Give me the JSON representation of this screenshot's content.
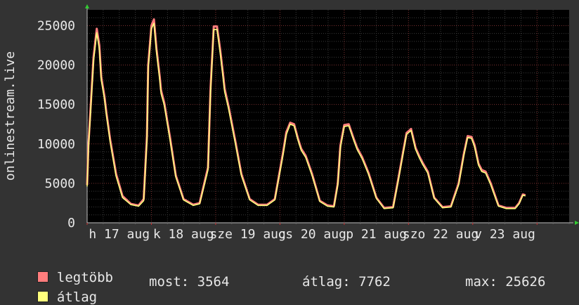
{
  "chart_data": {
    "type": "line",
    "ylabel": "onlinestream.live",
    "y_ticks": [
      "0",
      "5000",
      "10000",
      "15000",
      "20000",
      "25000"
    ],
    "ylim": [
      0,
      27000
    ],
    "x_tick_labels": [
      "h 17 aug",
      "k 18 aug",
      "sze 19 aug",
      "cs 20 aug",
      "p 21 aug",
      "szo 22 aug",
      "v 23 aug"
    ],
    "x_day_range": [
      0,
      7.5
    ],
    "grid": true,
    "series": [
      {
        "name": "legtöbb",
        "color": "#ff7d7d",
        "x": [
          0,
          0.02,
          0.1,
          0.15,
          0.19,
          0.22,
          0.27,
          0.3,
          0.36,
          0.45,
          0.55,
          0.68,
          0.8,
          0.88,
          0.93,
          0.95,
          1.0,
          1.04,
          1.08,
          1.13,
          1.15,
          1.2,
          1.29,
          1.38,
          1.5,
          1.65,
          1.75,
          1.88,
          1.92,
          1.97,
          2.02,
          2.07,
          2.12,
          2.14,
          2.2,
          2.3,
          2.4,
          2.53,
          2.66,
          2.8,
          2.92,
          3.05,
          3.1,
          3.16,
          3.22,
          3.28,
          3.33,
          3.4,
          3.5,
          3.62,
          3.74,
          3.84,
          3.9,
          3.94,
          4.0,
          4.07,
          4.15,
          4.2,
          4.28,
          4.38,
          4.5,
          4.62,
          4.76,
          4.84,
          4.91,
          4.97,
          5.04,
          5.11,
          5.17,
          5.22,
          5.3,
          5.4,
          5.53,
          5.66,
          5.78,
          5.86,
          5.92,
          5.98,
          6.03,
          6.09,
          6.14,
          6.2,
          6.28,
          6.4,
          6.52,
          6.66,
          6.72,
          6.78,
          6.82
        ],
        "y": [
          4800,
          9800,
          21000,
          24600,
          22500,
          18500,
          16000,
          14000,
          10500,
          6200,
          3400,
          2400,
          2200,
          3000,
          11000,
          20000,
          25000,
          25800,
          22000,
          18500,
          16800,
          15200,
          10800,
          6000,
          3000,
          2300,
          2500,
          7000,
          17000,
          24900,
          24900,
          22000,
          18500,
          17000,
          14800,
          10600,
          6200,
          3000,
          2300,
          2300,
          3000,
          9000,
          11500,
          12700,
          12500,
          10700,
          9400,
          8500,
          6200,
          2800,
          2200,
          2100,
          5000,
          9800,
          12400,
          12500,
          10600,
          9500,
          8300,
          6300,
          3200,
          1900,
          2000,
          5500,
          8700,
          11400,
          11900,
          9500,
          8400,
          7600,
          6500,
          3200,
          2000,
          2100,
          5000,
          8700,
          11000,
          10900,
          9800,
          7500,
          6700,
          6500,
          5000,
          2200,
          1900,
          1900,
          2500,
          3600,
          3500
        ]
      },
      {
        "name": "átlag",
        "color": "#ffff7d",
        "x": [
          0,
          0.02,
          0.1,
          0.15,
          0.19,
          0.22,
          0.27,
          0.3,
          0.36,
          0.45,
          0.55,
          0.68,
          0.8,
          0.88,
          0.93,
          0.95,
          1.0,
          1.04,
          1.08,
          1.13,
          1.15,
          1.2,
          1.29,
          1.38,
          1.5,
          1.65,
          1.75,
          1.88,
          1.92,
          1.97,
          2.02,
          2.07,
          2.12,
          2.14,
          2.2,
          2.3,
          2.4,
          2.53,
          2.66,
          2.8,
          2.92,
          3.05,
          3.1,
          3.16,
          3.22,
          3.28,
          3.33,
          3.4,
          3.5,
          3.62,
          3.74,
          3.84,
          3.9,
          3.94,
          4.0,
          4.07,
          4.15,
          4.2,
          4.28,
          4.38,
          4.5,
          4.62,
          4.76,
          4.84,
          4.91,
          4.97,
          5.04,
          5.11,
          5.17,
          5.22,
          5.3,
          5.4,
          5.53,
          5.66,
          5.78,
          5.86,
          5.92,
          5.98,
          6.03,
          6.09,
          6.14,
          6.2,
          6.28,
          6.4,
          6.52,
          6.66,
          6.72,
          6.78,
          6.82
        ],
        "y": [
          4600,
          9400,
          20500,
          24100,
          22000,
          18100,
          15700,
          13700,
          10200,
          5900,
          3200,
          2300,
          2100,
          2800,
          10500,
          19600,
          24600,
          25300,
          21600,
          18100,
          16400,
          14900,
          10500,
          5800,
          2900,
          2200,
          2400,
          6700,
          16600,
          24500,
          24500,
          21600,
          18100,
          16600,
          14500,
          10300,
          6000,
          2900,
          2200,
          2200,
          2900,
          8700,
          11200,
          12500,
          12300,
          10500,
          9200,
          8300,
          6000,
          2700,
          2100,
          2000,
          4800,
          9500,
          12200,
          12300,
          10400,
          9300,
          8100,
          6100,
          3100,
          1800,
          1900,
          5300,
          8500,
          11200,
          11700,
          9300,
          8200,
          7400,
          6300,
          3100,
          1900,
          2000,
          4800,
          8500,
          10800,
          10700,
          9600,
          7300,
          6500,
          6300,
          4800,
          2100,
          1800,
          1800,
          2400,
          3500,
          3400
        ]
      }
    ]
  },
  "legend": {
    "items": [
      {
        "label": "legtöbb",
        "color": "#ff7d7d"
      },
      {
        "label": "átlag",
        "color": "#ffff7d"
      }
    ]
  },
  "stats": {
    "most": "most: 3564",
    "atlag": "átlag: 7762",
    "max": "max: 25626"
  }
}
